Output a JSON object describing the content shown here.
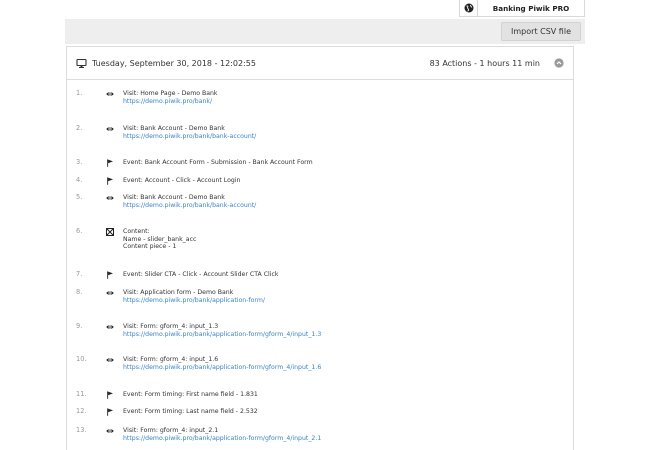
{
  "site_selector": {
    "site_name": "Banking Piwik PRO",
    "icon": "globe-icon"
  },
  "toolbar": {
    "import_label": "Import CSV file"
  },
  "session": {
    "date": "Tuesday, September 30, 2018 - 12:02:55",
    "summary": "83 Actions - 1 hours 11 min"
  },
  "actions": [
    {
      "num": "1.",
      "type": "visit",
      "title": "Visit: Home Page - Demo Bank",
      "url": "https://demo.piwik.pro/bank/"
    },
    {
      "num": "2.",
      "type": "visit",
      "title": "Visit: Bank Account - Demo Bank",
      "url": "https://demo.piwik.pro/bank/bank-account/"
    },
    {
      "num": "3.",
      "type": "event",
      "title": "Event: Bank Account Form - Submission - Bank Account Form"
    },
    {
      "num": "4.",
      "type": "event",
      "title": "Event: Account - Click - Account Login"
    },
    {
      "num": "5.",
      "type": "visit",
      "title": "Visit: Bank Account - Demo Bank",
      "url": "https://demo.piwik.pro/bank/bank-account/"
    },
    {
      "num": "6.",
      "type": "content",
      "lines": [
        "Content:",
        "Name - slider_bank_acc",
        "Content piece - 1"
      ]
    },
    {
      "num": "7.",
      "type": "event",
      "title": "Event: Slider CTA - Click - Account Slider CTA Click"
    },
    {
      "num": "8.",
      "type": "visit",
      "title": "Visit: Application form - Demo Bank",
      "url": "https://demo.piwik.pro/bank/application-form/"
    },
    {
      "num": "9.",
      "type": "visit",
      "title": "Visit: Form: gform_4: input_1.3",
      "url": "https://demo.piwik.pro/bank/application-form/gform_4/input_1.3"
    },
    {
      "num": "10.",
      "type": "visit",
      "title": "Visit: Form: gform_4: input_1.6",
      "url": "https://demo.piwik.pro/bank/application-form/gform_4/input_1.6"
    },
    {
      "num": "11.",
      "type": "event",
      "title": "Event: Form timing: First name field - 1.831"
    },
    {
      "num": "12.",
      "type": "event",
      "title": "Event: Form timing: Last name field - 2.532"
    },
    {
      "num": "13.",
      "type": "visit",
      "title": "Visit: Form: gform_4: input_2.1",
      "url": "https://demo.piwik.pro/bank/application-form/gform_4/input_2.1"
    }
  ]
}
